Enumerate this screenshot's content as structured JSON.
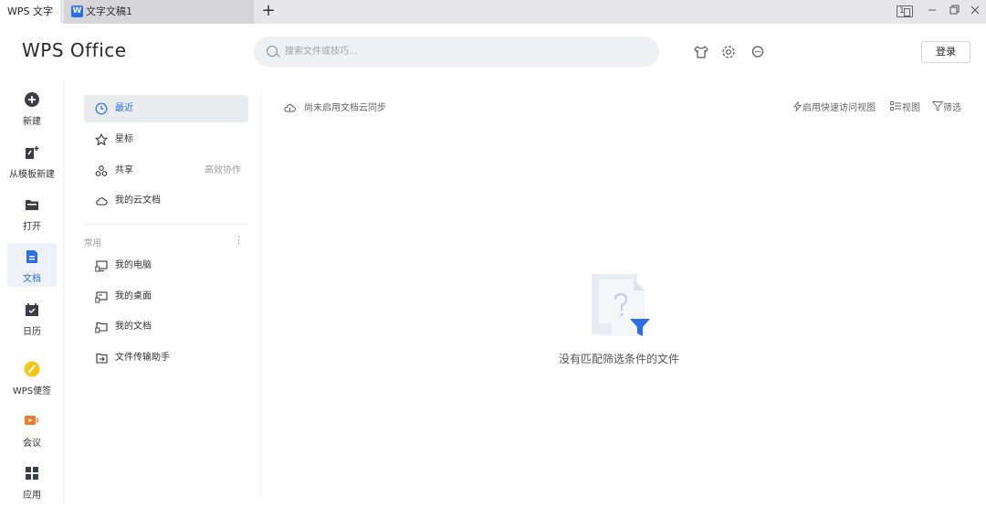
{
  "tabs": {
    "home_label": "WPS 文字",
    "doc_label": "文字文稿1",
    "doc_icon": "W",
    "add_label": "+",
    "layout_number": "1"
  },
  "header": {
    "logo": "WPS Office",
    "search_placeholder": "搜索文件或技巧...",
    "login_label": "登录"
  },
  "left_nav": {
    "items": [
      {
        "label": "新建",
        "icon": "plus-circle-icon"
      },
      {
        "label": "从模板新建",
        "icon": "template-icon"
      },
      {
        "label": "打开",
        "icon": "folder-icon"
      },
      {
        "label": "文档",
        "icon": "document-icon",
        "active": true
      },
      {
        "label": "日历",
        "icon": "calendar-icon"
      },
      {
        "label": "WPS便签",
        "icon": "note-icon"
      },
      {
        "label": "会议",
        "icon": "meeting-icon"
      },
      {
        "label": "应用",
        "icon": "apps-icon"
      }
    ]
  },
  "panel": {
    "items": [
      {
        "label": "最近",
        "icon": "clock-icon",
        "active": true
      },
      {
        "label": "星标",
        "icon": "star-icon"
      },
      {
        "label": "共享",
        "icon": "share-icon",
        "right": "高效协作"
      },
      {
        "label": "我的云文档",
        "icon": "cloud-icon"
      }
    ],
    "section_title": "常用",
    "section_more": "⋮",
    "common": [
      {
        "label": "我的电脑",
        "icon": "computer-icon"
      },
      {
        "label": "我的桌面",
        "icon": "desktop-icon"
      },
      {
        "label": "我的文档",
        "icon": "my-documents-icon"
      },
      {
        "label": "文件传输助手",
        "icon": "file-transfer-icon"
      }
    ]
  },
  "main": {
    "cloud_note": "尚未启用文档云同步",
    "quick_view": "启用快速访问视图",
    "view_label": "视图",
    "filter_label": "筛选",
    "empty_text": "没有匹配筛选条件的文件"
  },
  "colors": {
    "accent": "#2f6fe4",
    "note_yellow": "#f5c518",
    "meeting_orange": "#f07a2e"
  }
}
